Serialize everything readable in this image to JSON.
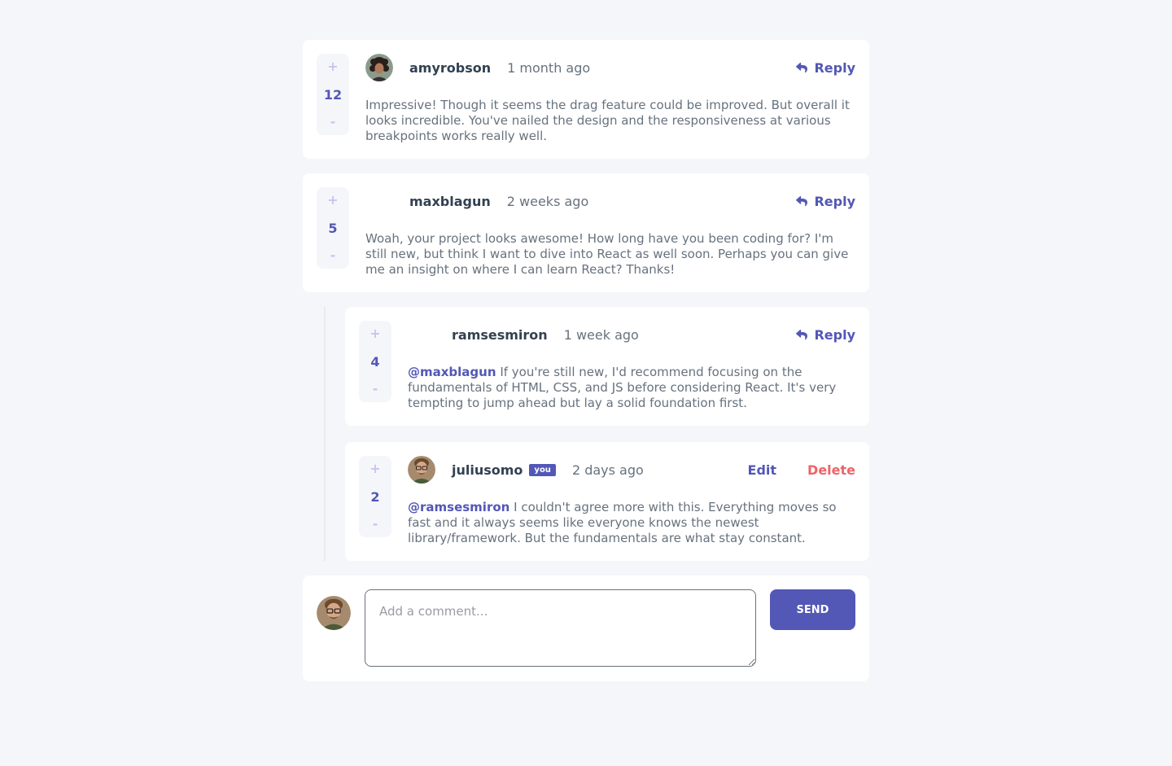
{
  "comments": [
    {
      "username": "amyrobson",
      "time": "1 month ago",
      "score": "12",
      "plus": "+",
      "minus": "-",
      "reply_label": "Reply",
      "text": "Impressive! Though it seems the drag feature could be improved. But overall it looks incredible. You've nailed the design and the responsiveness at various breakpoints works really well."
    },
    {
      "username": "maxblagun",
      "time": "2 weeks ago",
      "score": "5",
      "plus": "+",
      "minus": "-",
      "reply_label": "Reply",
      "text": "Woah, your project looks awesome! How long have you been coding for? I'm still new, but think I want to dive into React as well soon. Perhaps you can give me an insight on where I can learn React? Thanks!"
    }
  ],
  "replies": [
    {
      "username": "ramsesmiron",
      "time": "1 week ago",
      "score": "4",
      "plus": "+",
      "minus": "-",
      "reply_label": "Reply",
      "mention": "@maxblagun",
      "text": "If you're still new, I'd recommend focusing on the fundamentals of HTML, CSS, and JS before considering React. It's very tempting to jump ahead but lay a solid foundation first."
    },
    {
      "username": "juliusomo",
      "you_badge": "you",
      "time": "2 days ago",
      "score": "2",
      "plus": "+",
      "minus": "-",
      "edit_label": "Edit",
      "delete_label": "Delete",
      "mention": "@ramsesmiron",
      "text": "I couldn't agree more with this. Everything moves so fast and it always seems like everyone knows the newest library/framework. But the fundamentals are what stay constant."
    }
  ],
  "form": {
    "placeholder": "Add a comment...",
    "send_label": "SEND"
  },
  "icons": {
    "reply": "reply-arrow-icon"
  },
  "colors": {
    "accent": "#5357b6",
    "danger": "#ed6368",
    "background": "#f5f6fa",
    "text_dark": "#324152",
    "text": "#67727e",
    "vote_light": "#c5c6ef"
  }
}
